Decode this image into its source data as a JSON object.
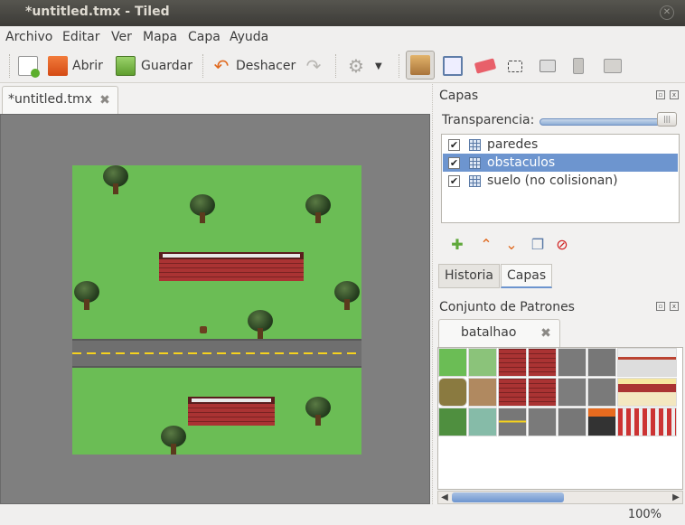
{
  "window": {
    "title": "*untitled.tmx - Tiled"
  },
  "menu": [
    "Archivo",
    "Editar",
    "Ver",
    "Mapa",
    "Capa",
    "Ayuda"
  ],
  "toolbar": {
    "open_label": "Abrir",
    "save_label": "Guardar",
    "undo_label": "Deshacer"
  },
  "document": {
    "tab_label": "*untitled.tmx"
  },
  "layers_panel": {
    "title": "Capas",
    "opacity_label": "Transparencia:",
    "opacity": 1.0,
    "layers": [
      {
        "name": "paredes",
        "visible": true,
        "selected": false
      },
      {
        "name": "obstaculos",
        "visible": true,
        "selected": true
      },
      {
        "name": "suelo (no colisionan)",
        "visible": true,
        "selected": false
      }
    ],
    "tabs": [
      "Historia",
      "Capas"
    ],
    "active_tab": "Capas"
  },
  "tileset_panel": {
    "title": "Conjunto de Patrones",
    "tab_label": "batalhao"
  },
  "status": {
    "zoom": "100%"
  },
  "colors": {
    "accent": "#6d95cf",
    "grass": "#6bbd55",
    "canvas_bg": "#7f7f7f"
  }
}
